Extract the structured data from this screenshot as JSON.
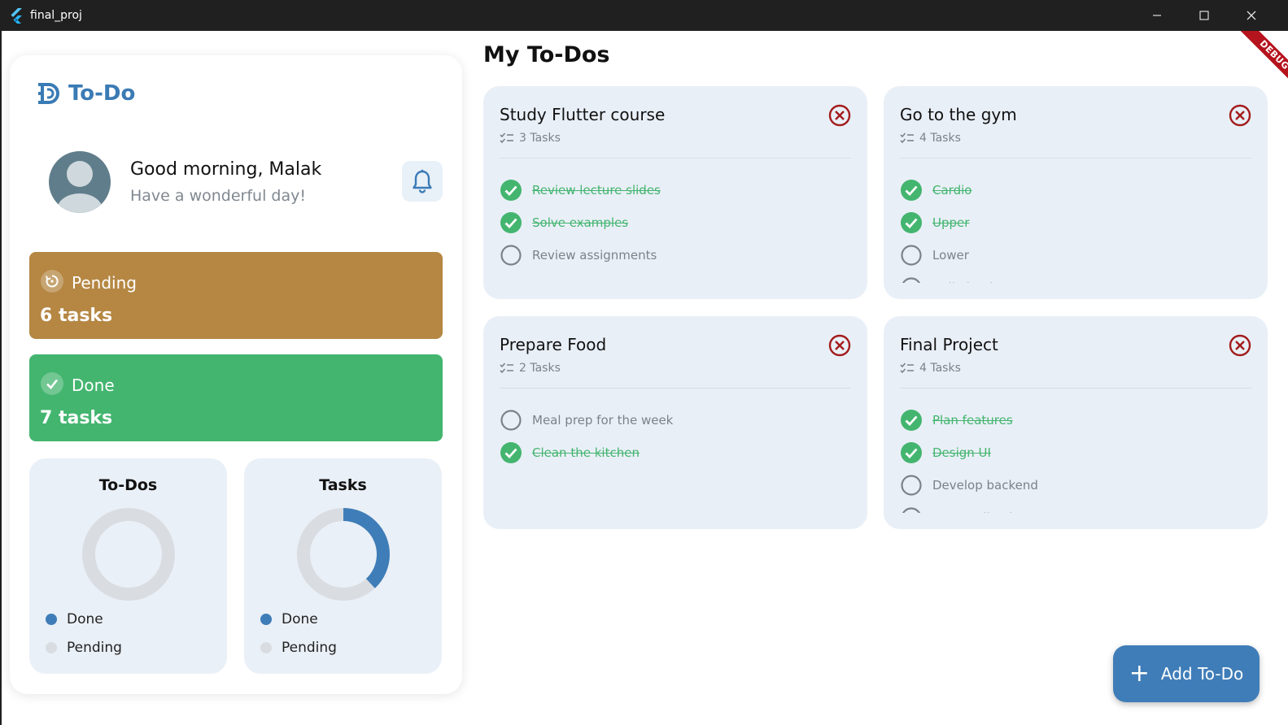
{
  "window": {
    "title": "final_proj",
    "debug_label": "DEBUG"
  },
  "sidebar": {
    "logo_text": "To-Do",
    "greeting": "Good morning, Malak",
    "subgreeting": "Have a wonderful day!",
    "pending": {
      "label": "Pending",
      "value": "6 tasks",
      "color": "#b58743"
    },
    "done": {
      "label": "Done",
      "value": "7 tasks",
      "color": "#43b56f"
    },
    "todos_chart": {
      "title": "To-Dos",
      "done_fraction": 0,
      "legend": [
        "Done",
        "Pending"
      ]
    },
    "tasks_chart": {
      "title": "Tasks",
      "done_fraction": 0.38,
      "legend": [
        "Done",
        "Pending"
      ]
    }
  },
  "main": {
    "title": "My To-Dos",
    "cards": [
      {
        "title": "Study Flutter course",
        "count": "3 Tasks",
        "tasks": [
          {
            "text": "Review lecture slides",
            "done": true
          },
          {
            "text": "Solve examples",
            "done": true
          },
          {
            "text": "Review assignments",
            "done": false
          }
        ]
      },
      {
        "title": "Go to the gym",
        "count": "4 Tasks",
        "tasks": [
          {
            "text": "Cardio",
            "done": true
          },
          {
            "text": "Upper",
            "done": true
          },
          {
            "text": "Lower",
            "done": false
          },
          {
            "text": "Calisthenics",
            "done": false
          }
        ]
      },
      {
        "title": "Prepare Food",
        "count": "2 Tasks",
        "tasks": [
          {
            "text": "Meal prep for the week",
            "done": false
          },
          {
            "text": "Clean the kitchen",
            "done": true
          }
        ]
      },
      {
        "title": "Final Project",
        "count": "4 Tasks",
        "tasks": [
          {
            "text": "Plan features",
            "done": true
          },
          {
            "text": "Design UI",
            "done": true
          },
          {
            "text": "Develop backend",
            "done": false
          },
          {
            "text": "Test application",
            "done": false
          }
        ]
      }
    ],
    "add_button_label": "Add To-Do"
  },
  "colors": {
    "accent": "#3f7db8",
    "done_green": "#43b56f",
    "pending_brown": "#b58743",
    "delete_red": "#a31c1c",
    "card_bg": "#e9eff7",
    "donut_track": "#d9dde2"
  },
  "icons": {
    "logo": "double-d-logo-icon",
    "bell": "bell-icon",
    "pending": "refresh-icon",
    "done": "check-icon",
    "delete": "circle-x-icon",
    "task_count": "checklist-icon",
    "add": "plus-icon"
  }
}
